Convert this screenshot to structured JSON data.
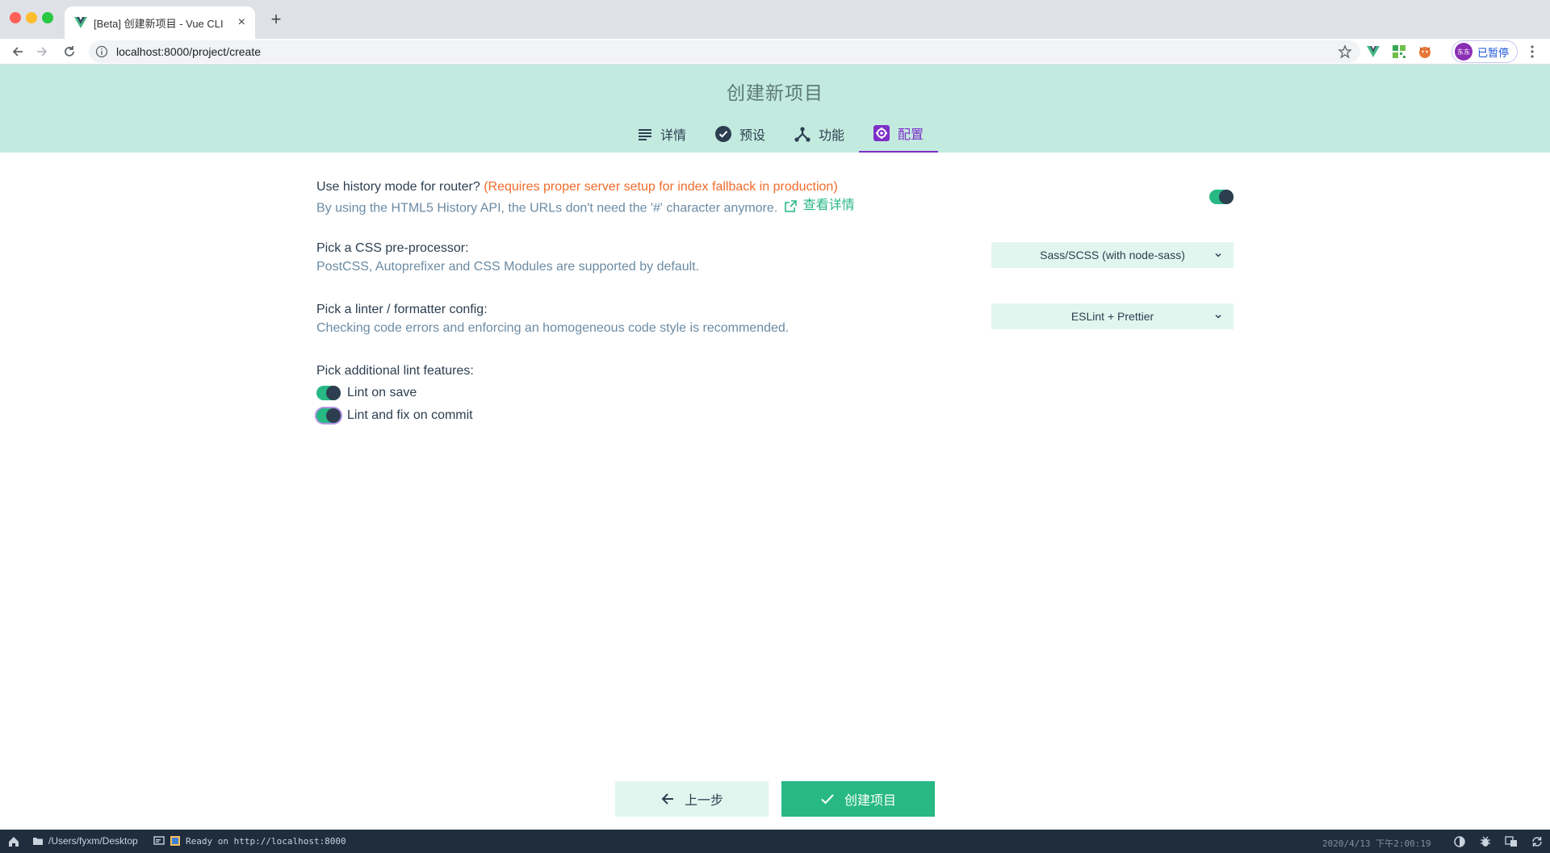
{
  "browser": {
    "tab_title": "[Beta] 创建新项目 - Vue CLI",
    "close_glyph": "×",
    "newtab_glyph": "+",
    "url": "localhost:8000/project/create",
    "profile_avatar": "东东",
    "profile_label": "已暂停"
  },
  "header": {
    "title": "创建新项目",
    "steps": [
      {
        "label": "详情",
        "icon": "list-icon"
      },
      {
        "label": "预设",
        "icon": "check-circle-icon"
      },
      {
        "label": "功能",
        "icon": "fork-icon"
      },
      {
        "label": "配置",
        "icon": "settings-icon",
        "active": true
      }
    ]
  },
  "config": {
    "history": {
      "label": "Use history mode for router?",
      "warning": "(Requires proper server setup for index fallback in production)",
      "desc": "By using the HTML5 History API, the URLs don't need the '#' character anymore.",
      "link": "查看详情",
      "enabled": true
    },
    "css": {
      "label": "Pick a CSS pre-processor:",
      "desc": "PostCSS, Autoprefixer and CSS Modules are supported by default.",
      "value": "Sass/SCSS (with node-sass)"
    },
    "linter": {
      "label": "Pick a linter / formatter config:",
      "desc": "Checking code errors and enforcing an homogeneous code style is recommended.",
      "value": "ESLint + Prettier"
    },
    "lint_features": {
      "label": "Pick additional lint features:",
      "options": [
        {
          "label": "Lint on save",
          "checked": true
        },
        {
          "label": "Lint and fix on commit",
          "checked": true
        }
      ]
    }
  },
  "footer": {
    "prev_label": "上一步",
    "create_label": "创建项目"
  },
  "statusbar": {
    "path": "/Users/fyxm/Desktop",
    "message": "Ready on http://localhost:8000",
    "time": "2020/4/13 下午2:00:19"
  },
  "colors": {
    "accent": "#27b884",
    "header_bg": "#c3eadf",
    "active_tab": "#7e2fc8",
    "warning": "#f16b2b",
    "statusbar_bg": "#1f2d3d"
  }
}
